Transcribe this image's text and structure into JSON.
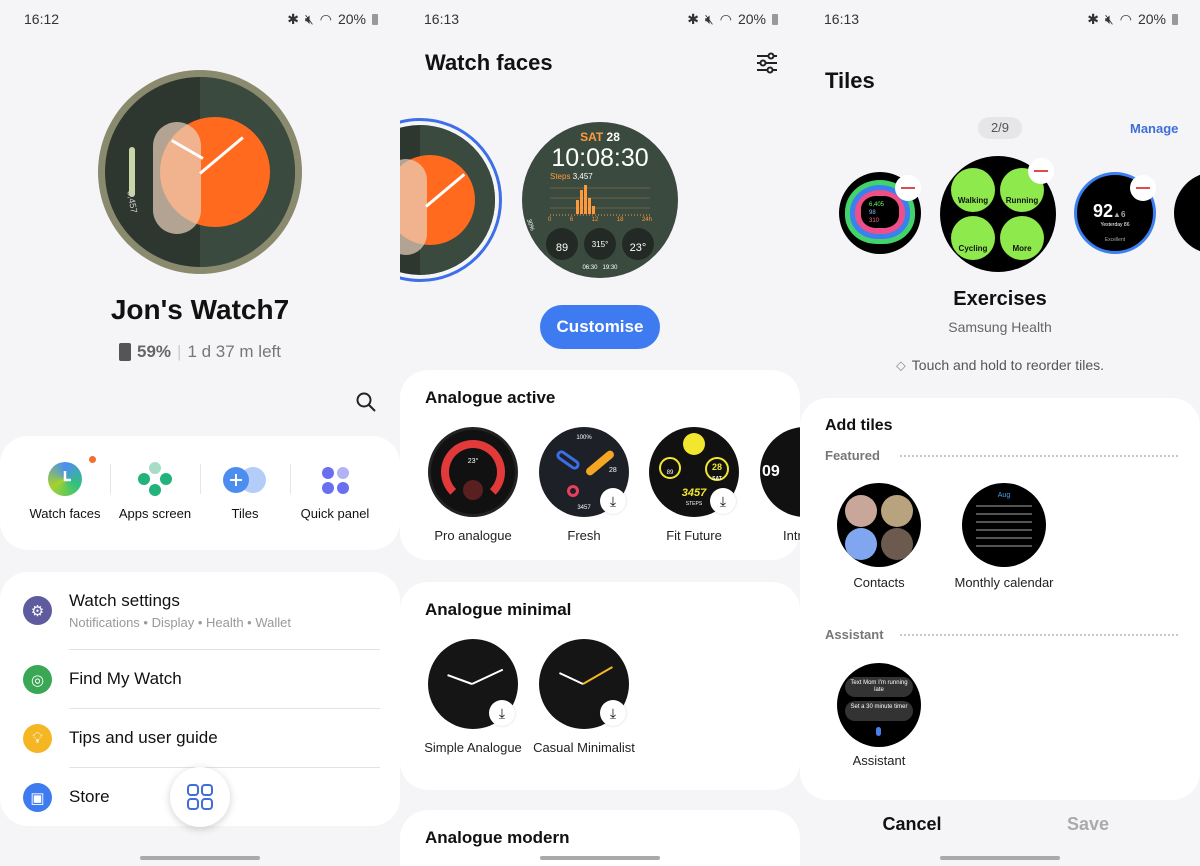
{
  "colors": {
    "accent": "#3e7bf0",
    "background": "#f5f5f7",
    "card": "#ffffff",
    "tile_green": "#8ee94c",
    "watch_orange": "#ff6a1f"
  },
  "panel1": {
    "status": {
      "time": "16:12",
      "battery": "20%"
    },
    "device_name": "Jon's Watch7",
    "battery_percent": "59%",
    "battery_left": "1 d 37 m left",
    "watch_face_text": "3,457",
    "shortcuts": [
      {
        "label": "Watch faces",
        "icon": "watch-face-icon"
      },
      {
        "label": "Apps screen",
        "icon": "apps-icon"
      },
      {
        "label": "Tiles",
        "icon": "tiles-icon"
      },
      {
        "label": "Quick panel",
        "icon": "quick-panel-icon"
      }
    ],
    "menu": [
      {
        "title": "Watch settings",
        "subtitle": "Notifications • Display • Health • Wallet",
        "icon": "gear-icon",
        "color": "#5e5b9e"
      },
      {
        "title": "Find My Watch",
        "icon": "find-icon",
        "color": "#3aa755"
      },
      {
        "title": "Tips and user guide",
        "icon": "lightbulb-icon",
        "color": "#f5b623"
      },
      {
        "title": "Store",
        "icon": "bag-icon",
        "color": "#3e7bf0"
      }
    ]
  },
  "panel2": {
    "status": {
      "time": "16:13",
      "battery": "20%"
    },
    "title": "Watch faces",
    "current_face": {
      "day": "SAT",
      "date": "28",
      "time": "10:08:30",
      "steps_label": "Steps",
      "steps": "3,457",
      "axis": [
        "0",
        "6",
        "12",
        "18",
        "24h"
      ],
      "heart": "89",
      "compass": "315°",
      "temp": "23°",
      "sunrise": "06:30",
      "sunset": "19:30",
      "battery": "30%"
    },
    "customise_label": "Customise",
    "sections": [
      {
        "title": "Analogue active",
        "faces": [
          {
            "name": "Pro analogue",
            "download": false
          },
          {
            "name": "Fresh",
            "download": true
          },
          {
            "name": "Fit Future",
            "download": true
          },
          {
            "name": "Intr",
            "download": false
          }
        ]
      },
      {
        "title": "Analogue minimal",
        "faces": [
          {
            "name": "Simple Analogue",
            "download": true
          },
          {
            "name": "Casual Minimalist",
            "download": true
          }
        ]
      },
      {
        "title": "Analogue modern",
        "faces": []
      }
    ],
    "face_texts": {
      "fresh_top": "100%",
      "fresh_date": "28",
      "fresh_steps": "3457",
      "fit_date": "28",
      "fit_day": "SAT",
      "fit_steps": "3457",
      "fit_steps_label": "STEPS",
      "fit_heart": "89",
      "pro_temp": "23°",
      "intr_hour": "09"
    }
  },
  "panel3": {
    "status": {
      "time": "16:13",
      "battery": "20%"
    },
    "title": "Tiles",
    "page_indicator": "2/9",
    "manage_label": "Manage",
    "tiles_row": {
      "activity": [
        "6,405",
        "98",
        "310"
      ],
      "exercises": [
        "Walking",
        "Running",
        "Cycling",
        "More"
      ],
      "sleep": {
        "value": "92",
        "delta": "▲6",
        "sub": "Yesterday 86",
        "status": "Excellent"
      }
    },
    "selected_tile": {
      "name": "Exercises",
      "app": "Samsung Health"
    },
    "hint": "Touch and hold to reorder tiles.",
    "add_tiles_title": "Add tiles",
    "groups": [
      {
        "title": "Featured",
        "tiles": [
          {
            "name": "Contacts"
          },
          {
            "name": "Monthly calendar"
          }
        ]
      },
      {
        "title": "Assistant",
        "tiles": [
          {
            "name": "Assistant"
          }
        ]
      }
    ],
    "calendar_month": "Aug",
    "assistant_prompts": [
      "Text Mom I'm running late",
      "Set a 30 minute timer"
    ],
    "cancel_label": "Cancel",
    "save_label": "Save"
  }
}
